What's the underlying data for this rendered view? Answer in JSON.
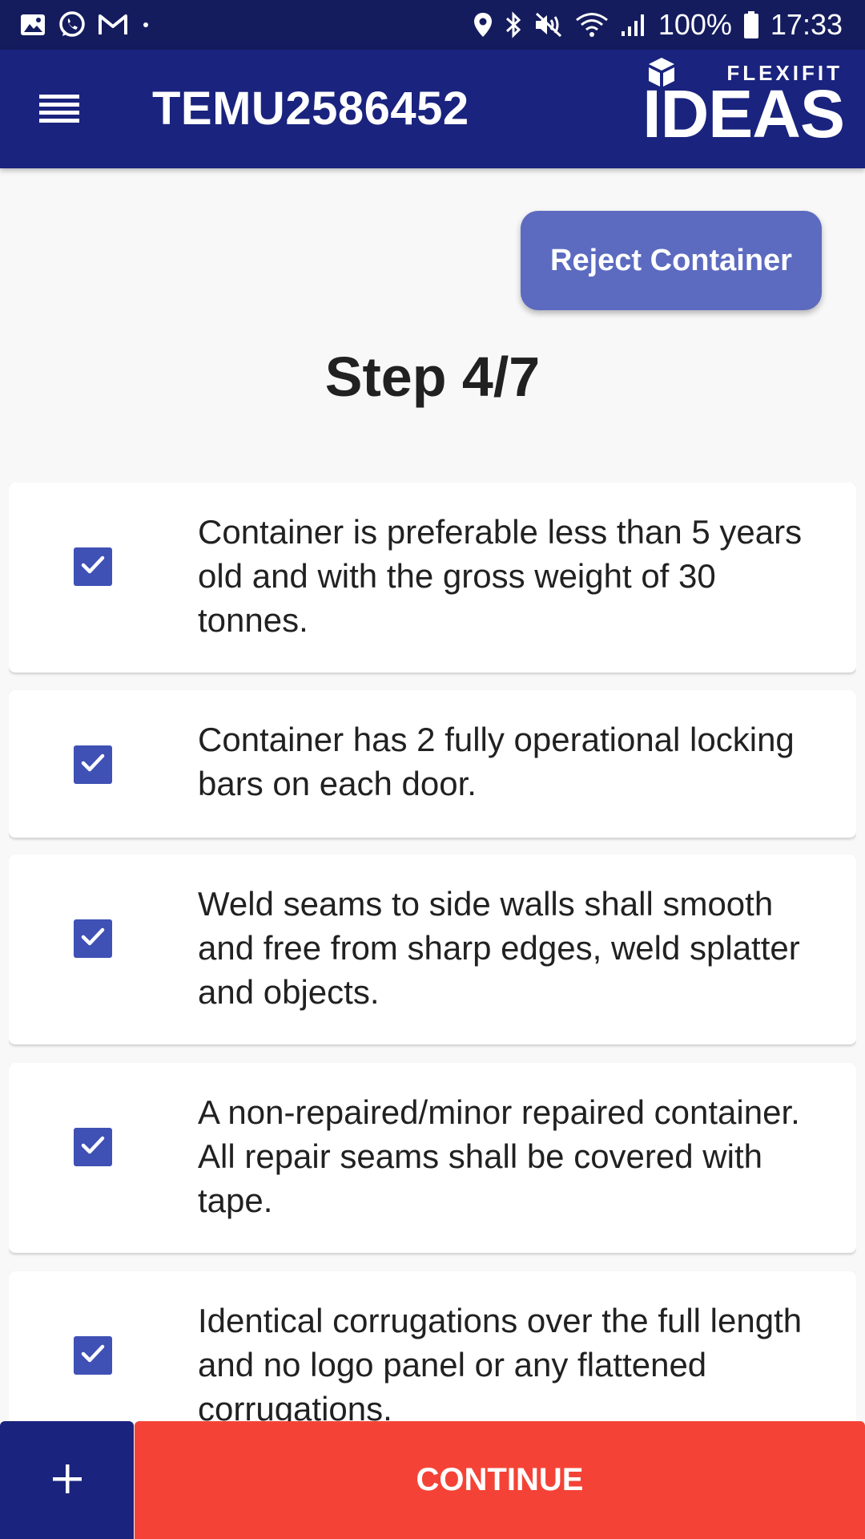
{
  "status_bar": {
    "left_icons": [
      "gallery-icon",
      "whatsapp-icon",
      "gmail-icon",
      "dot-icon"
    ],
    "right_icons": [
      "location-icon",
      "bluetooth-icon",
      "mute-icon",
      "wifi-icon",
      "signal-icon"
    ],
    "battery": "100%",
    "time": "17:33"
  },
  "app_bar": {
    "title": "TEMU2586452",
    "menu_icon": "hamburger-menu-icon",
    "logo_top": "FLEXIFIT",
    "logo_main": "IDEAS"
  },
  "reject_button": {
    "label": "Reject Container"
  },
  "step": {
    "title": "Step 4/7"
  },
  "checklist": {
    "items": [
      {
        "text": "Container is preferable less than 5 years old and with the gross weight of 30 tonnes.",
        "checked": true
      },
      {
        "text": "Container has 2 fully operational locking bars on each door.",
        "checked": true
      },
      {
        "text": "Weld seams to side walls shall smooth and free from sharp edges, weld splatter and objects.",
        "checked": true
      },
      {
        "text": "A non-repaired/minor repaired container. All repair seams shall be covered with tape.",
        "checked": true
      },
      {
        "text": "Identical corrugations over the full length and no logo panel or any flattened corrugations.",
        "checked": true
      }
    ]
  },
  "bottom_bar": {
    "add_icon": "plus-icon",
    "continue_label": "CONTINUE"
  },
  "colors": {
    "status_bar": "#141c5e",
    "app_bar": "#1a237e",
    "reject_button": "#5c6bc0",
    "checkbox": "#3f51b5",
    "continue": "#f44336"
  }
}
